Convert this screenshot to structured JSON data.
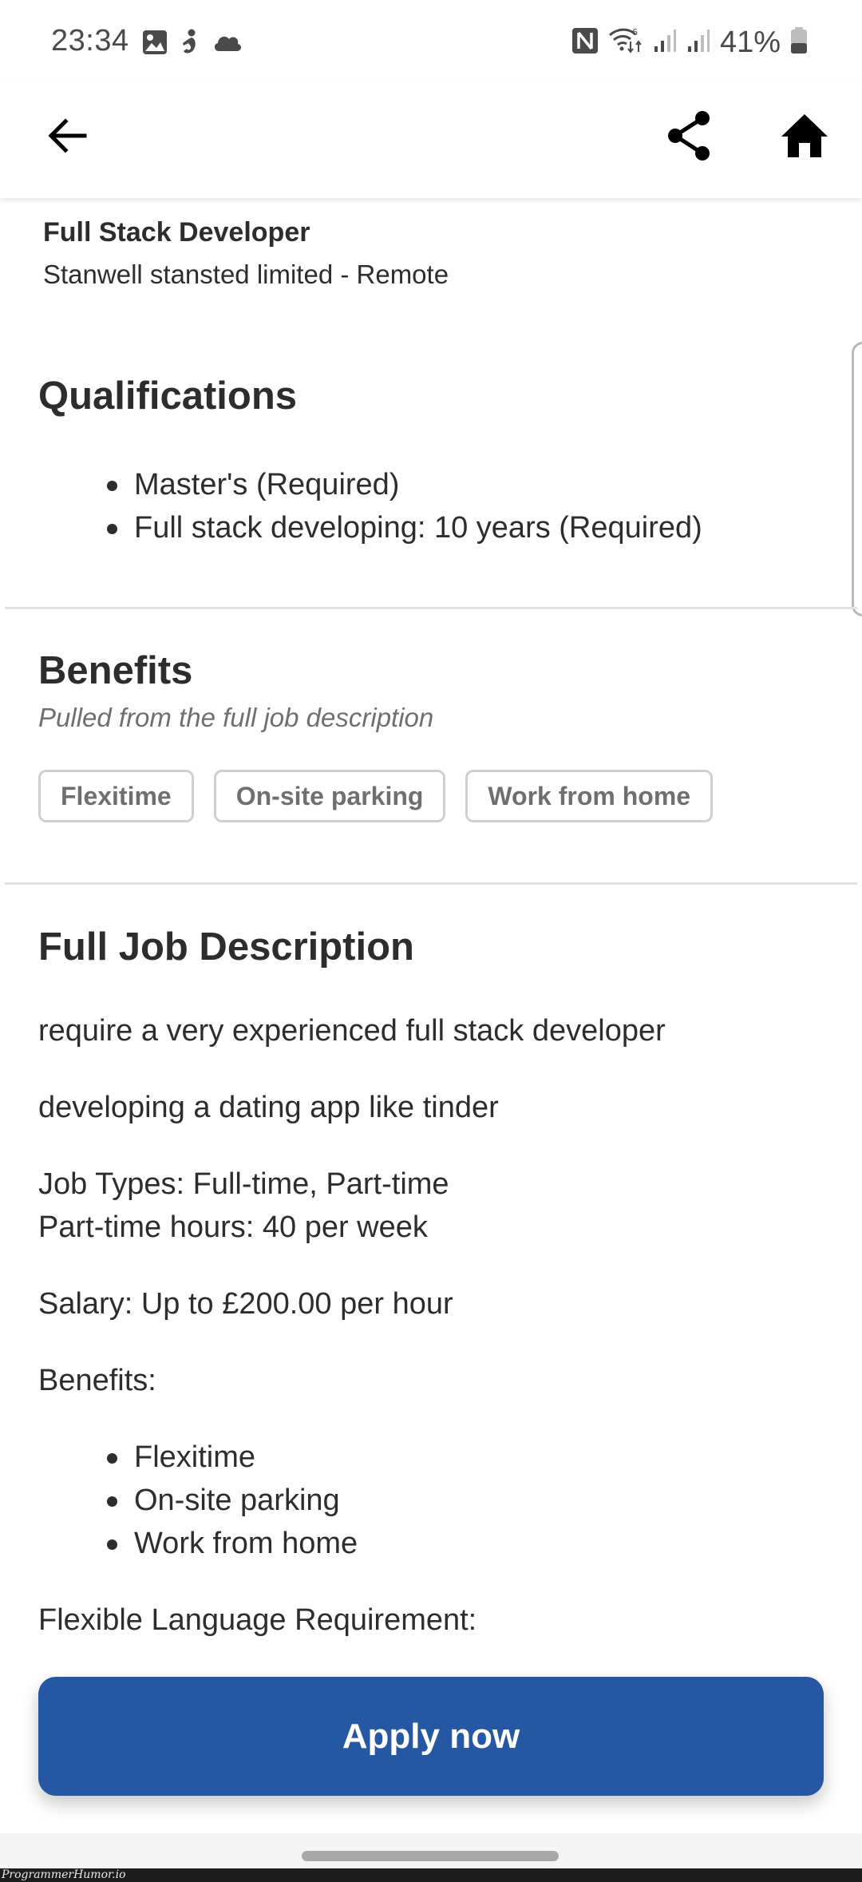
{
  "status_bar": {
    "time": "23:34",
    "left_icons": [
      "gallery-icon",
      "yoga-app-icon",
      "cloud-icon"
    ],
    "right_icons": [
      "nfc-icon",
      "wifi-6-icon",
      "signal-sim1-icon",
      "signal-sim2-icon"
    ],
    "battery_percent": "41%",
    "battery_level": 0.41
  },
  "app_bar": {
    "back_icon": "arrow-back-icon",
    "share_icon": "share-icon",
    "home_icon": "home-icon"
  },
  "job": {
    "title": "Full Stack Developer",
    "company_location": "Stanwell stansted limited - Remote"
  },
  "qualifications": {
    "heading": "Qualifications",
    "items": [
      "Master's (Required)",
      "Full stack developing: 10 years (Required)"
    ]
  },
  "benefits": {
    "heading": "Benefits",
    "subtitle": "Pulled from the full job description",
    "chips": [
      "Flexitime",
      "On-site parking",
      "Work from home"
    ]
  },
  "full_description": {
    "heading": "Full Job Description",
    "p1": "require a very experienced full stack developer",
    "p2": "developing a dating app like tinder",
    "job_types": "Job Types: Full-time, Part-time",
    "part_time_hours": "Part-time hours: 40 per week",
    "salary": "Salary: Up to £200.00 per hour",
    "benefits_label": "Benefits:",
    "benefits_items": [
      "Flexitime",
      "On-site parking",
      "Work from home"
    ],
    "language_req": "Flexible Language Requirement:"
  },
  "apply_button": {
    "label": "Apply now",
    "color": "#2557a3"
  },
  "watermark": "ProgrammerHumor.io"
}
